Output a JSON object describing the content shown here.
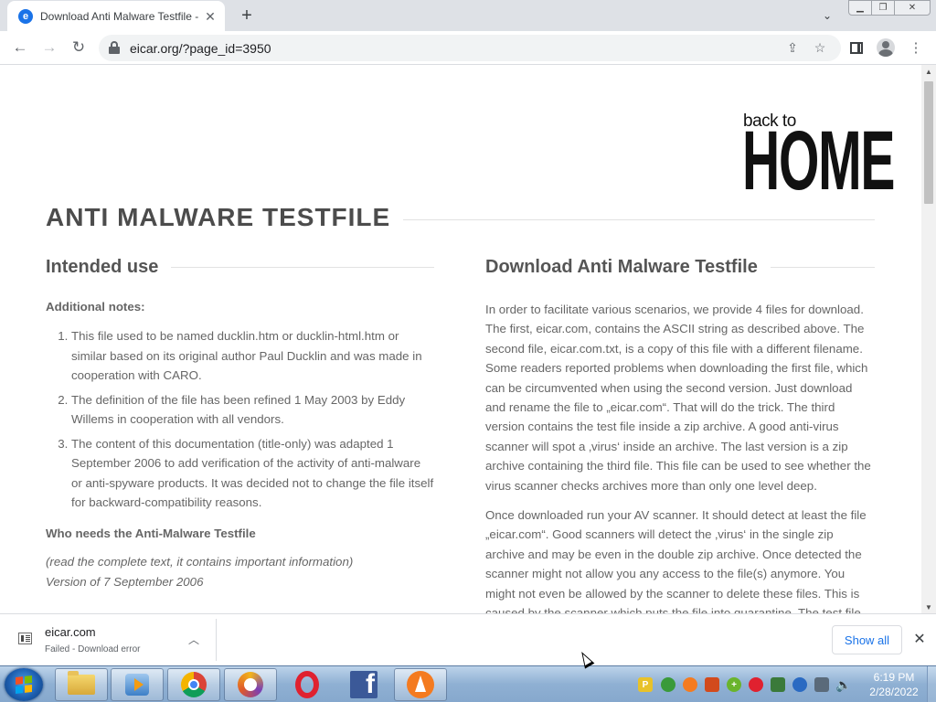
{
  "browser": {
    "tab": {
      "title": "Download Anti Malware Testfile - ",
      "favicon": "e"
    },
    "new_tab_symbol": "+",
    "url": "eicar.org/?page_id=3950"
  },
  "page": {
    "logo": {
      "small": "back to",
      "big": "HOME"
    },
    "title": "ANTI MALWARE TESTFILE",
    "left": {
      "heading": "Intended use",
      "notes_label": "Additional notes:",
      "notes": [
        "This file used to be named ducklin.htm or ducklin-html.htm or similar based on its original author Paul Ducklin and was made in cooperation with CARO.",
        "The definition of the file has been refined 1 May 2003 by Eddy Willems in cooperation with all vendors.",
        "The content of this documentation (title-only) was adapted 1 September 2006 to add verification of the activity of anti-malware or anti-spyware products. It was decided not to change the file itself for backward-compatibility reasons."
      ],
      "who_heading": "Who needs the Anti-Malware Testfile",
      "read_text": "(read the complete text, it contains important information)",
      "version": "Version of 7 September 2006"
    },
    "right": {
      "heading": "Download Anti Malware Testfile",
      "para1": "In order to facilitate various scenarios, we provide 4 files for download. The first, eicar.com, contains the ASCII string as described above. The second file, eicar.com.txt, is a copy of this file with a different filename. Some readers reported problems when downloading the first file, which can be circumvented when using the second version. Just download and rename the file to „eicar.com“. That will do the trick. The third version contains the test file inside a zip archive. A good anti-virus scanner will spot a ‚virus‘ inside an archive. The last version is a zip archive containing the third file. This file can be used to see whether the virus scanner checks archives more than only one level deep.",
      "para2": "Once downloaded run your AV scanner. It should detect at least the file „eicar.com“. Good scanners will detect the ‚virus‘ in the single zip archive and may be even in the double zip archive. Once detected the scanner might not allow you any access to the file(s) anymore. You might not even be allowed by the scanner to delete these files. This is caused by the scanner which puts the file into quarantine. The test file will be"
    }
  },
  "downloads": {
    "filename": "eicar.com",
    "status": "Failed - Download error",
    "show_all": "Show all"
  },
  "taskbar": {
    "apps": [
      "file-explorer-icon",
      "media-player-icon",
      "chrome-icon",
      "circle-app-icon",
      "opera-icon",
      "facebook-icon",
      "avast-icon"
    ],
    "active_app": "chrome-icon",
    "time": "6:19 PM",
    "date": "2/28/2022"
  },
  "colors": {
    "link_blue": "#1a73e8",
    "heading_gray": "#4c4c4c",
    "body_gray": "#666666",
    "taskbar_blue": "#8fb0d3"
  }
}
